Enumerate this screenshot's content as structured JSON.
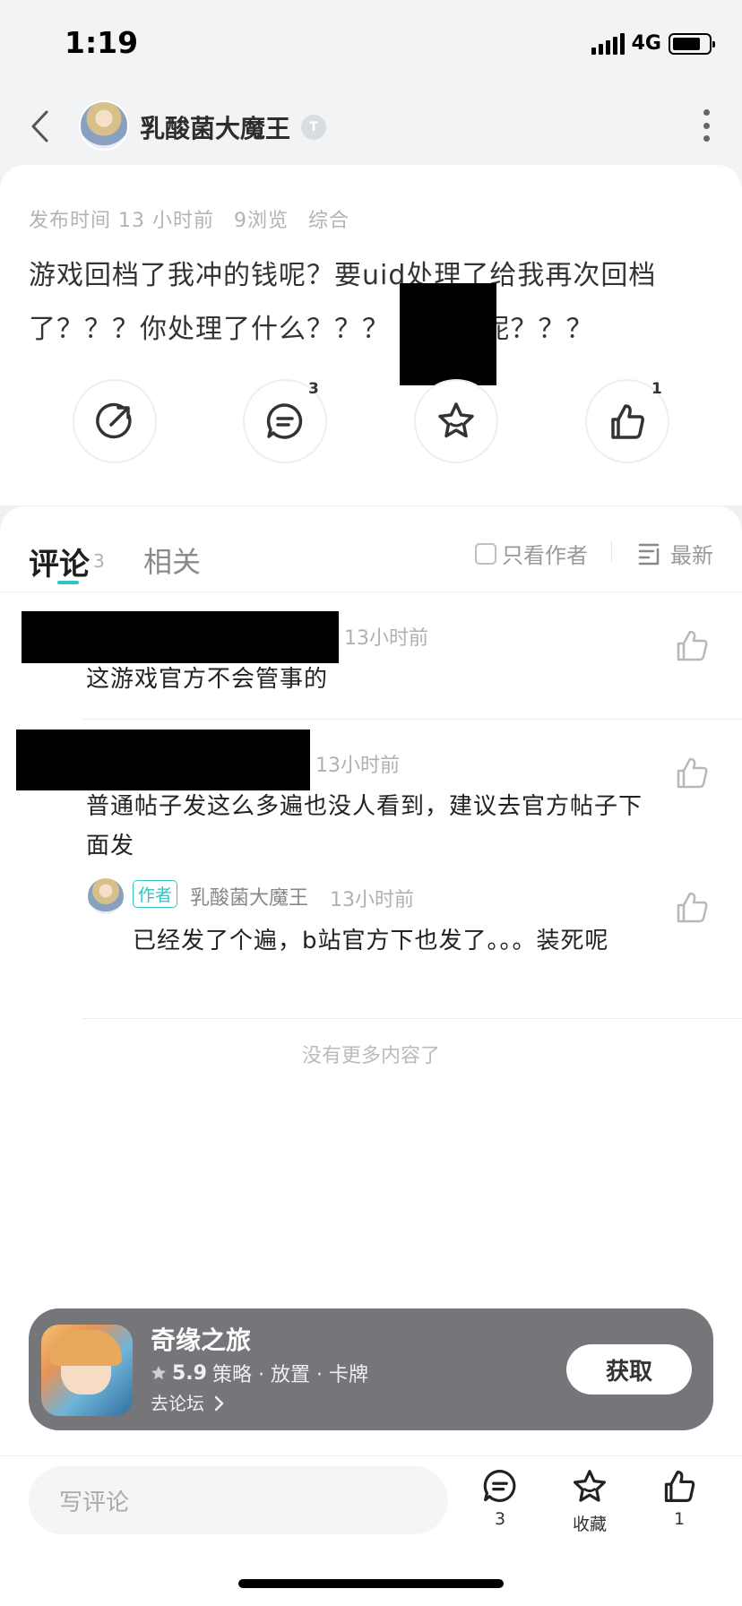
{
  "status_bar": {
    "time": "1:19",
    "network": "4G"
  },
  "header": {
    "author_name": "乳酸菌大魔王",
    "level_badge": "T"
  },
  "post": {
    "meta": {
      "publish": "发布时间 13 小时前",
      "views": "9浏览",
      "category": "综合"
    },
    "body": "游戏回档了我冲的钱呢？要uid处理了给我再次回档了？？？你处理了什么？？？        我的钱呢？？？",
    "actions": {
      "comment_count": "3",
      "like_count": "1"
    }
  },
  "comments_section": {
    "tab_comments": "评论",
    "tab_comments_count": "3",
    "tab_related": "相关",
    "author_only": "只看作者",
    "sort": "最新",
    "comments": [
      {
        "time": "13小时前",
        "text": "这游戏官方不会管事的"
      },
      {
        "time": "13小时前",
        "text": "普通帖子发这么多遍也没人看到，建议去官方帖子下面发"
      }
    ],
    "reply": {
      "tag": "作者",
      "name": "乳酸菌大魔王",
      "time": "13小时前",
      "text": "已经发了个遍，b站官方下也发了。。。装死呢"
    },
    "no_more": "没有更多内容了"
  },
  "game_bar": {
    "title": "奇缘之旅",
    "rating": "5.9",
    "tags": "策略 · 放置 · 卡牌",
    "forum_link": "去论坛",
    "get_button": "获取"
  },
  "bottom_bar": {
    "input_placeholder": "写评论",
    "comment_count": "3",
    "favorite_label": "收藏",
    "like_count": "1"
  },
  "colors": {
    "accent": "#2ec5c5",
    "game_bar_bg": "#75767a"
  }
}
